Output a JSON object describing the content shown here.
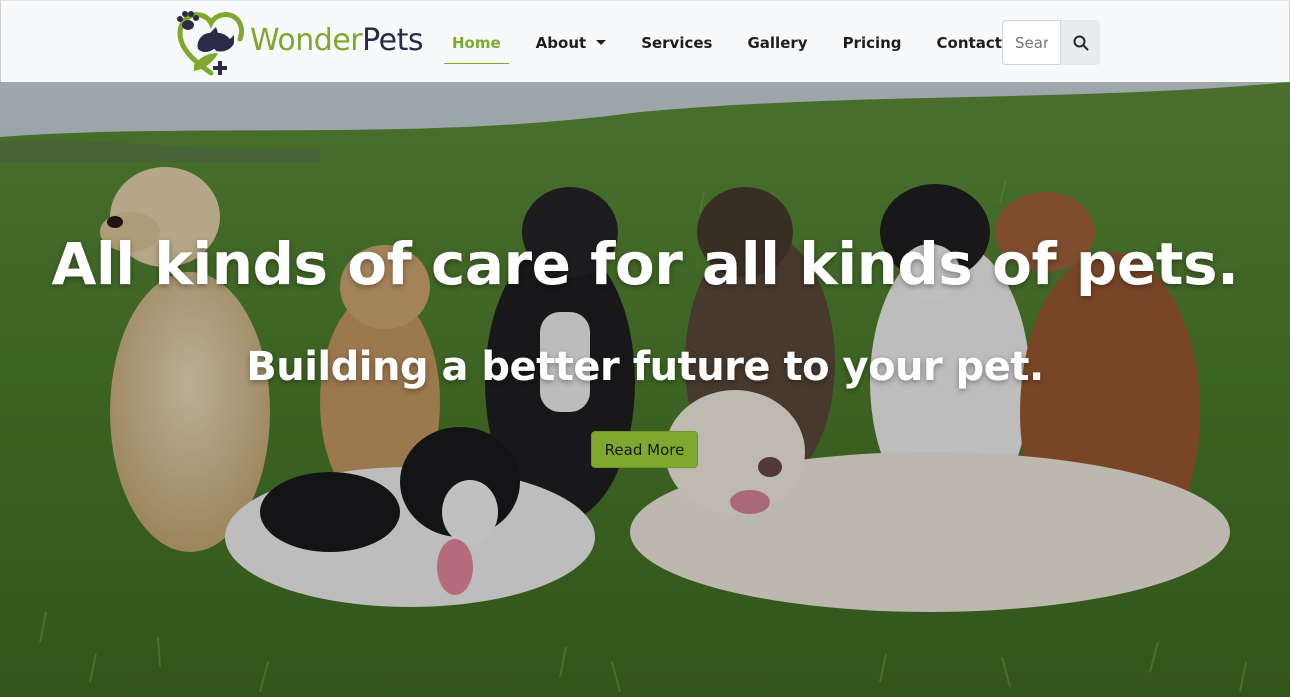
{
  "navbar": {
    "brand": {
      "wonder": "Wonder",
      "pets": "Pets",
      "logo_icon": "paw-heart-cross-icon",
      "colors": {
        "wonder": "#7fa82e",
        "pets": "#2b2b48"
      }
    },
    "links": [
      {
        "label": "Home",
        "active": true
      },
      {
        "label": "About",
        "dropdown": true
      },
      {
        "label": "Services"
      },
      {
        "label": "Gallery"
      },
      {
        "label": "Pricing"
      },
      {
        "label": "Contact"
      }
    ],
    "search": {
      "placeholder": "Search",
      "button_icon": "search-icon"
    }
  },
  "hero": {
    "title": "All kinds of care for all kinds of pets.",
    "subtitle": "Building a better future to your pet.",
    "button_label": "Read More",
    "background": "dogs-on-meadow-photo"
  },
  "colors": {
    "accent": "#7fa82e",
    "navbar_bg": "#f8f9fa",
    "text_dark": "#1e1e1e"
  }
}
